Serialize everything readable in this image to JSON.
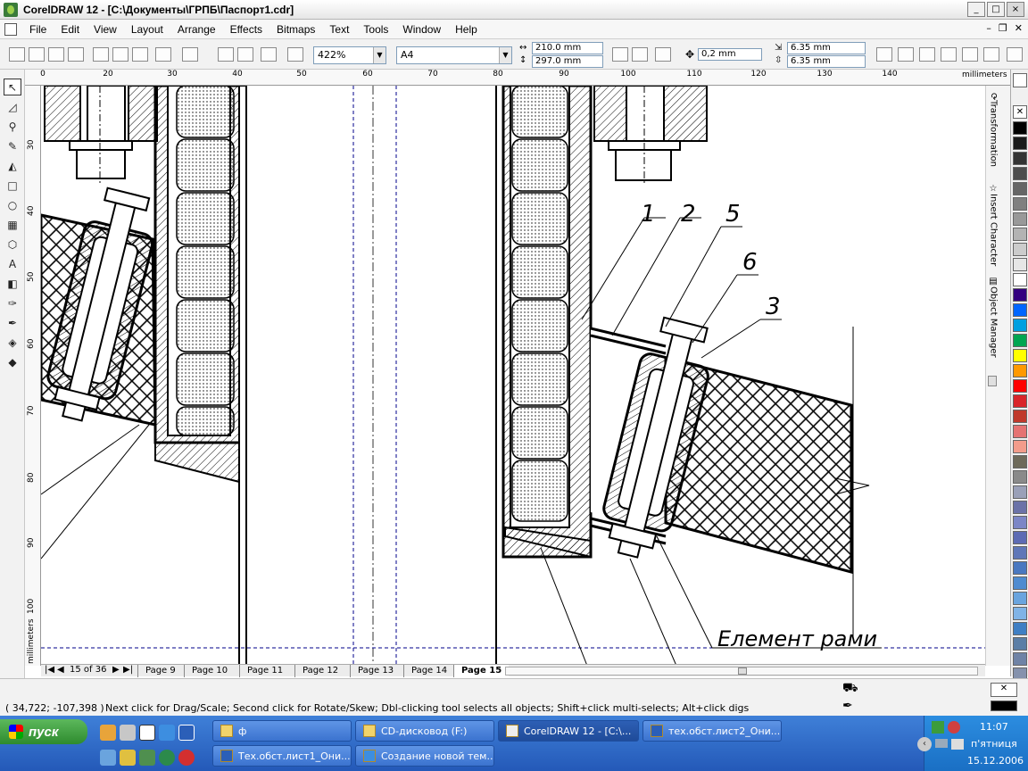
{
  "window": {
    "title": "CorelDRAW 12 - [C:\\Документы\\ГРПБ\\Паспорт1.cdr]",
    "buttons": [
      "_",
      "□",
      "×"
    ]
  },
  "menu": {
    "items": [
      "File",
      "Edit",
      "View",
      "Layout",
      "Arrange",
      "Effects",
      "Bitmaps",
      "Text",
      "Tools",
      "Window",
      "Help"
    ]
  },
  "toolbar": {
    "zoom": "422%",
    "paper": "A4",
    "width": "210.0 mm",
    "height": "297.0 mm",
    "nudge": "0,2 mm",
    "dup_x": "6.35 mm",
    "dup_y": "6.35 mm"
  },
  "ruler": {
    "units": "millimeters",
    "h_ticks": [
      "0",
      "20",
      "30",
      "40",
      "50",
      "60",
      "70",
      "80",
      "90",
      "100",
      "110",
      "120",
      "130",
      "140"
    ],
    "v_ticks": [
      "30",
      "40",
      "50",
      "60",
      "70",
      "80",
      "90",
      "100"
    ]
  },
  "dockers": {
    "transformation": "Transformation",
    "insert_character": "Insert Character",
    "object_manager": "Object Manager"
  },
  "palette": {
    "colors": [
      "#000000",
      "#1a1a1a",
      "#333333",
      "#4d4d4d",
      "#666666",
      "#808080",
      "#999999",
      "#b3b3b3",
      "#cccccc",
      "#e6e6e6",
      "#ffffff",
      "#33007f",
      "#0066ff",
      "#00a0e0",
      "#00a651",
      "#ffff00",
      "#ff9900",
      "#ff0000",
      "#d9252a",
      "#c0392b",
      "#e57373",
      "#f29c8b",
      "#6e6a5a",
      "#8a8a8a",
      "#9aa0b8",
      "#6b72a8",
      "#7c86c6",
      "#5d6bb4",
      "#5f77b8",
      "#4a78c0",
      "#4f8bd0",
      "#6aa4de",
      "#80b3e6",
      "#3f7fc4",
      "#5b7ea6",
      "#6f83a6",
      "#8592ad"
    ]
  },
  "drawing": {
    "callouts": [
      "1",
      "2",
      "5",
      "6",
      "3"
    ],
    "caption": "Елемент рами"
  },
  "pages": {
    "counter": "15 of 36",
    "tabs": [
      "Page 9",
      "Page 10",
      "Page 11",
      "Page 12",
      "Page 13",
      "Page 14",
      "Page 15"
    ],
    "active": "Page 15"
  },
  "status": {
    "coords": "( 34,722; -107,398 )",
    "hint": "Next click for Drag/Scale; Second click for Rotate/Skew; Dbl-clicking tool selects all objects; Shift+click multi-selects; Alt+click digs"
  },
  "taskbar": {
    "start": "пуск",
    "row1": [
      "ф",
      "CD-дисковод (F:)",
      "CorelDRAW 12 - [C:\\...",
      "тех.обст.лист2_Они..."
    ],
    "row2": [
      "Тех.обст.лист1_Они...",
      "Создание новой тем..."
    ],
    "clock": {
      "time": "11:07",
      "day": "п'ятниця",
      "date": "15.12.2006"
    }
  }
}
